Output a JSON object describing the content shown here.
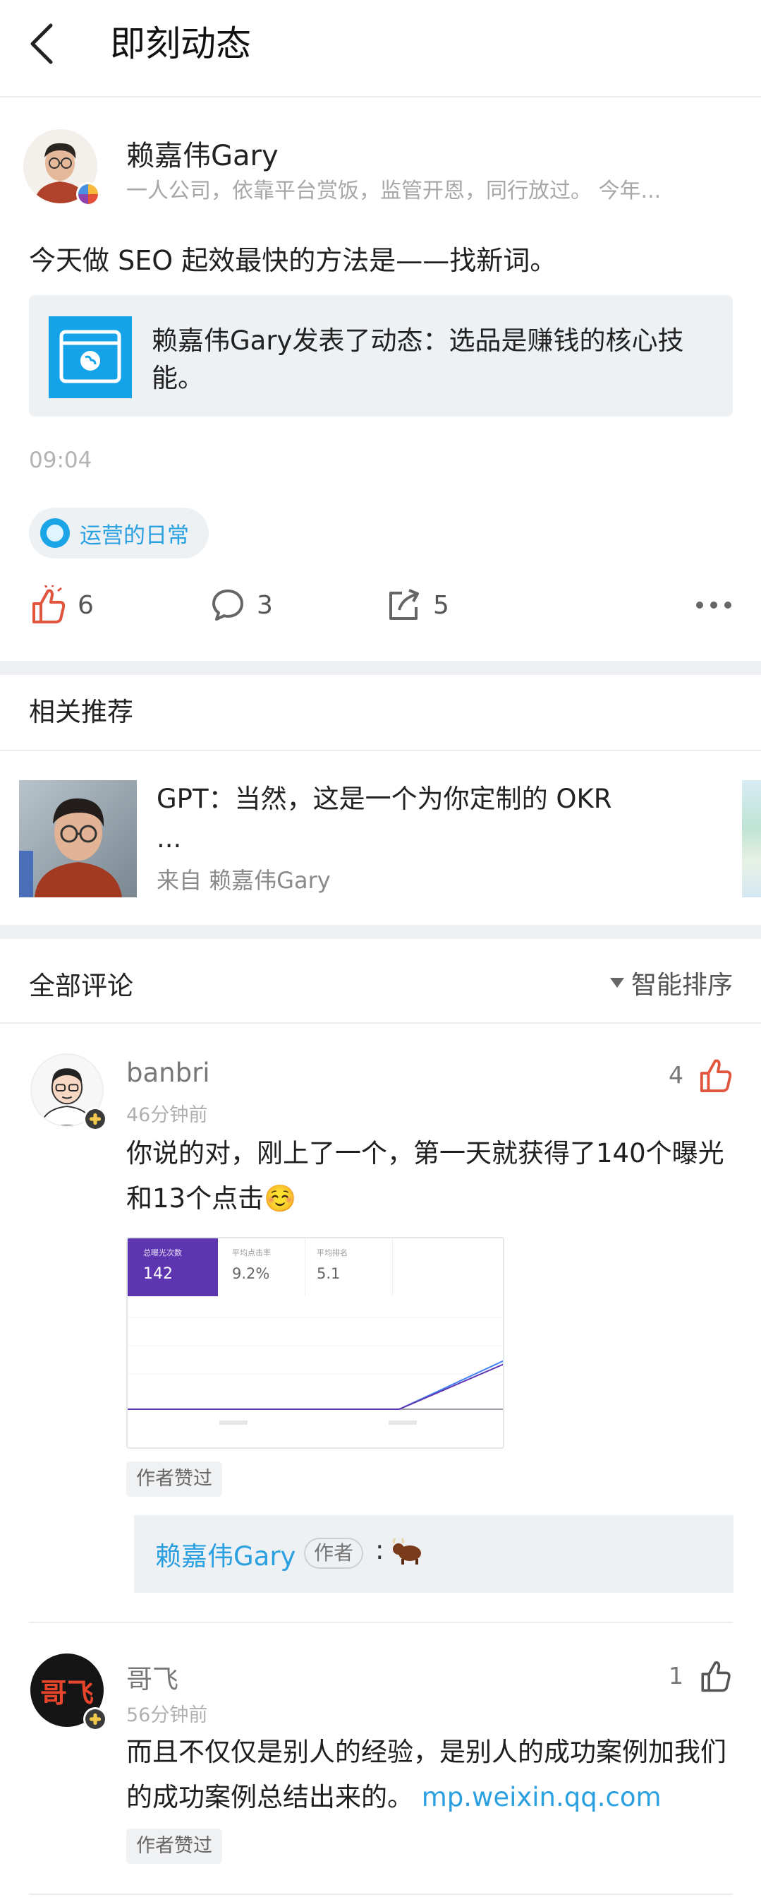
{
  "header": {
    "title": "即刻动态"
  },
  "post": {
    "author": "赖嘉伟Gary",
    "bio": "一人公司，依靠平台赏饭，监管开恩，同行放过。 今年...",
    "text": "今天做 SEO 起效最快的方法是——找新词。",
    "link_card": {
      "icon": "web-globe-icon",
      "text": "赖嘉伟Gary发表了动态：选品是赚钱的核心技能。"
    },
    "time": "09:04",
    "topic": "运营的日常",
    "actions": {
      "likes": "6",
      "comments": "3",
      "shares": "5"
    }
  },
  "recommend": {
    "title": "相关推荐",
    "item": {
      "title": "GPT：当然，这是一个为你定制的 OKR",
      "ellipsis": "...",
      "source": "来自 赖嘉伟Gary"
    }
  },
  "comments_section": {
    "title": "全部评论",
    "sort": "智能排序"
  },
  "comments": [
    {
      "name": "banbri",
      "time": "46分钟前",
      "likes": "4",
      "text": "你说的对，刚上了一个，第一天就获得了140个曝光和13个点击☺️",
      "screenshot": {
        "tiles": [
          {
            "label": "总曝光次数",
            "value": "142"
          },
          {
            "label": "平均点击率",
            "value": "9.2%"
          },
          {
            "label": "平均排名",
            "value": "5.1"
          }
        ]
      },
      "author_liked": "作者赞过",
      "reply": {
        "name": "赖嘉伟Gary",
        "tag": "作者",
        "colon": ":",
        "emoji": "ox-emoji"
      }
    },
    {
      "name": "哥飞",
      "avatar_text": "哥飞",
      "time": "56分钟前",
      "likes": "1",
      "text": "而且不仅仅是别人的经验，是别人的成功案例加我们的成功案例总结出来的。",
      "link": "mp.weixin.qq.com",
      "author_liked": "作者赞过"
    }
  ],
  "colors": {
    "accent": "#2aa0e0",
    "like_red": "#e1553f",
    "topic_bg": "#eef1f4"
  }
}
